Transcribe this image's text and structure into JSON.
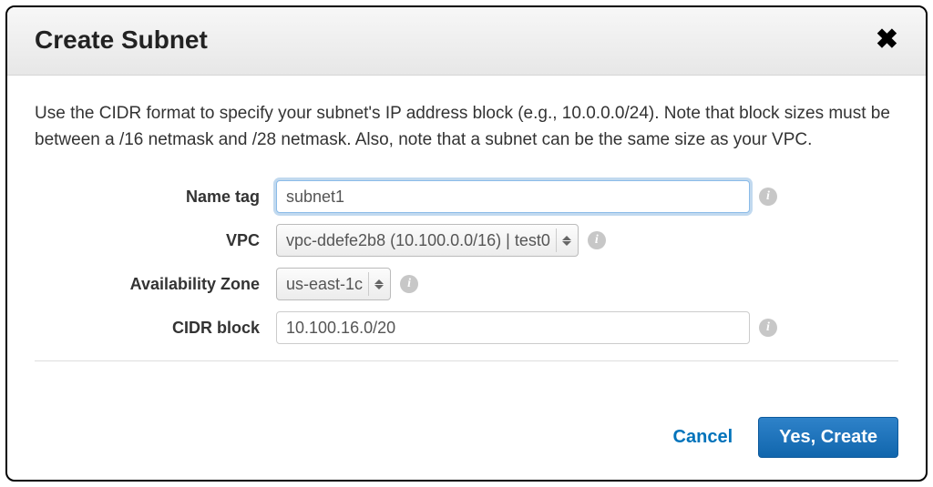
{
  "dialog": {
    "title": "Create Subnet",
    "description": "Use the CIDR format to specify your subnet's IP address block (e.g., 10.0.0.0/24). Note that block sizes must be between a /16 netmask and /28 netmask. Also, note that a subnet can be the same size as your VPC."
  },
  "form": {
    "name_tag": {
      "label": "Name tag",
      "value": "subnet1"
    },
    "vpc": {
      "label": "VPC",
      "selected": "vpc-ddefe2b8 (10.100.0.0/16) | test0"
    },
    "availability_zone": {
      "label": "Availability Zone",
      "selected": "us-east-1c"
    },
    "cidr_block": {
      "label": "CIDR block",
      "value": "10.100.16.0/20"
    }
  },
  "actions": {
    "cancel": "Cancel",
    "confirm": "Yes, Create"
  },
  "info_glyph": "i"
}
